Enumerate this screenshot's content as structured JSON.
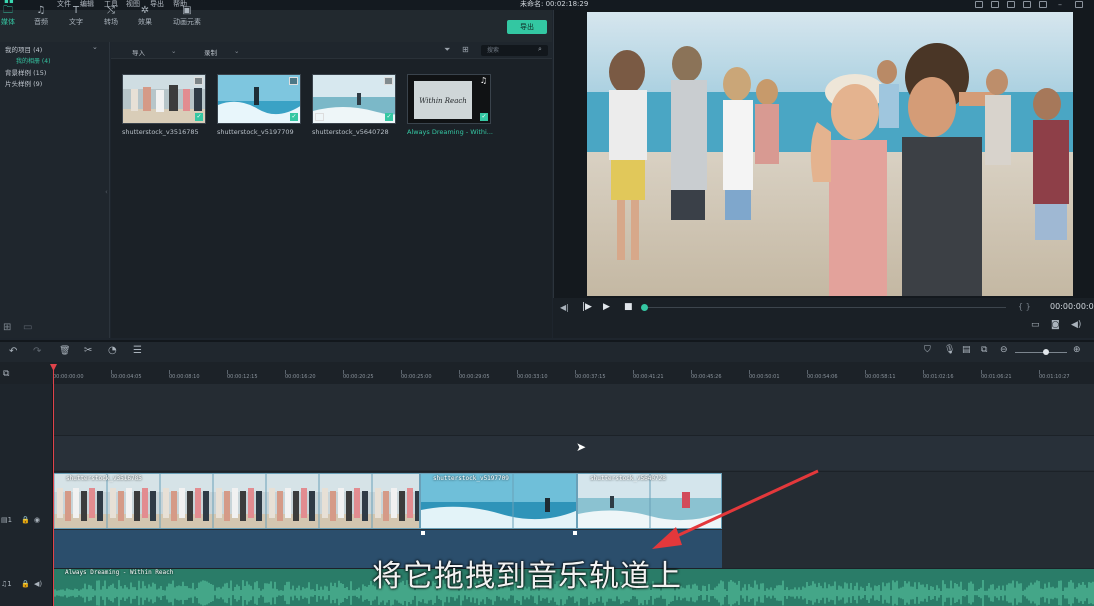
{
  "menubar": {
    "items": [
      "文件",
      "编辑",
      "工具",
      "视图",
      "导出",
      "帮助"
    ],
    "title": "未命名: 00:02:18:29"
  },
  "toolbar": {
    "tabs": [
      {
        "label": "媒体",
        "icon": "folder-icon"
      },
      {
        "label": "音频",
        "icon": "music-icon"
      },
      {
        "label": "文字",
        "icon": "text-icon"
      },
      {
        "label": "转场",
        "icon": "transition-icon"
      },
      {
        "label": "效果",
        "icon": "effects-icon"
      },
      {
        "label": "动画元素",
        "icon": "image-icon"
      }
    ],
    "export_label": "导出"
  },
  "library": {
    "items": [
      {
        "label": "我的项目 (4)"
      },
      {
        "label": "我的相册 (4)"
      },
      {
        "label": "背景样例 (15)"
      },
      {
        "label": "片头样例 (9)"
      }
    ]
  },
  "mediabar": {
    "import_label": "导入",
    "record_label": "录制",
    "search_placeholder": "搜索"
  },
  "media": [
    {
      "name": "shutterstock_v3516785"
    },
    {
      "name": "shutterstock_v5197709"
    },
    {
      "name": "shutterstock_v5640728"
    },
    {
      "name": "Always Dreaming - Withi..."
    }
  ],
  "preview": {
    "timecode": "00:00:00:0"
  },
  "ruler": {
    "ticks": [
      "00:00:00:00",
      "00:00:04:05",
      "00:00:08:10",
      "00:00:12:15",
      "00:00:16:20",
      "00:00:20:25",
      "00:00:25:00",
      "00:00:29:05",
      "00:00:33:10",
      "00:00:37:15",
      "00:00:41:21",
      "00:00:45:26",
      "00:00:50:01",
      "00:00:54:06",
      "00:00:58:11",
      "00:01:02:16",
      "00:01:06:21",
      "00:01:10:27"
    ]
  },
  "clips": {
    "video": [
      {
        "name": "shutterstock_v3516785"
      },
      {
        "name": "shutterstock_v5197709"
      },
      {
        "name": "shutterstock_v5640728"
      }
    ],
    "audio": {
      "name": "Always Dreaming - Within Reach"
    }
  },
  "caption": "将它拖拽到音乐轨道上",
  "colors": {
    "accent": "#35c7a3",
    "playhead": "#e0434a",
    "audio_track": "#2e8a72",
    "annotation_arrow": "#e3383b"
  }
}
